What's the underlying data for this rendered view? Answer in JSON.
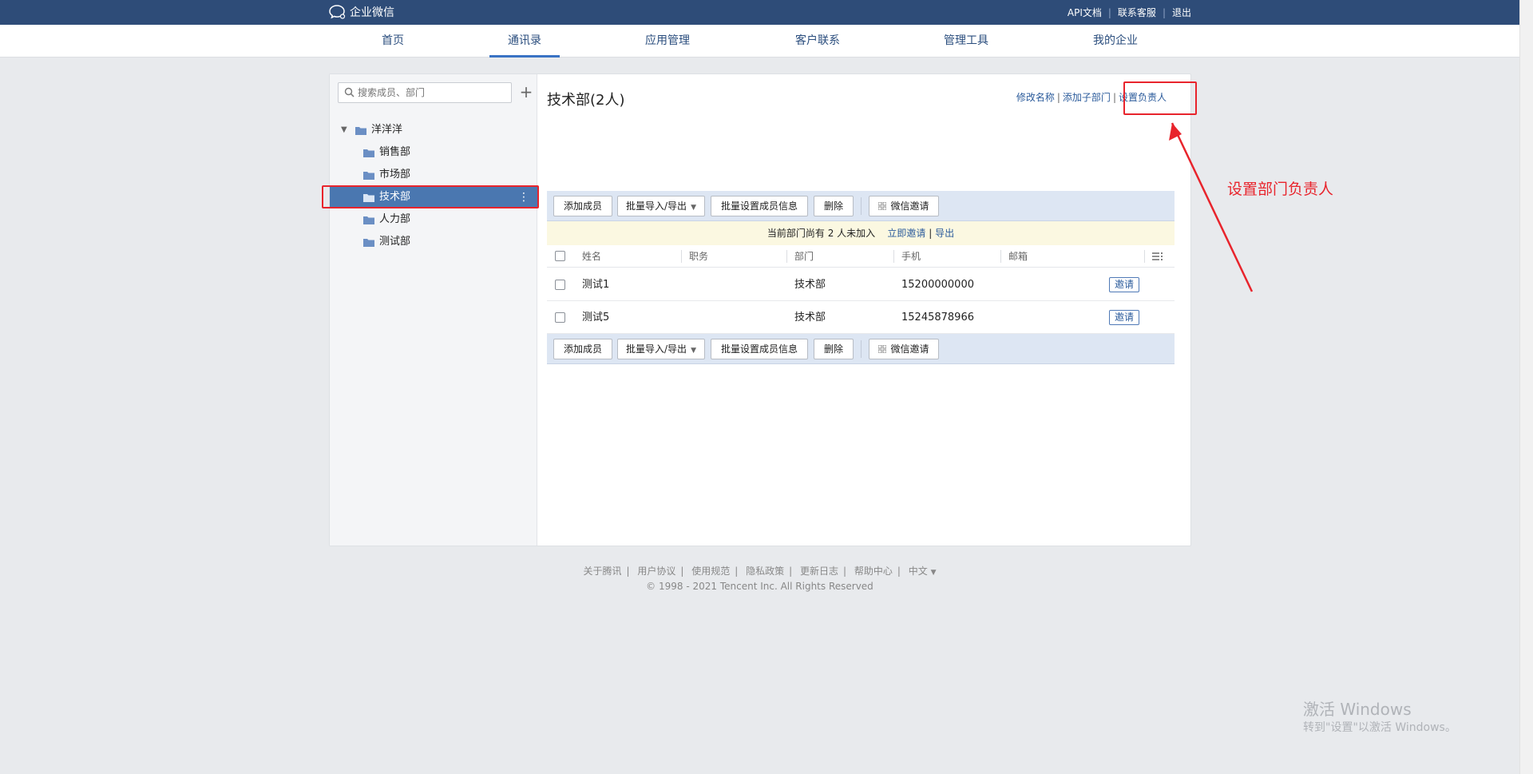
{
  "topbar": {
    "logo_text": "企业微信",
    "links": [
      "API文档",
      "联系客服",
      "退出"
    ]
  },
  "nav": {
    "items": [
      "首页",
      "通讯录",
      "应用管理",
      "客户联系",
      "管理工具",
      "我的企业"
    ],
    "active": "通讯录"
  },
  "sidebar": {
    "search_placeholder": "搜索成员、部门",
    "root": "洋洋洋",
    "departments": [
      "销售部",
      "市场部",
      "技术部",
      "人力部",
      "测试部"
    ],
    "selected": "技术部"
  },
  "content": {
    "title": "技术部(2人)",
    "actions": [
      "修改名称",
      "添加子部门",
      "设置负责人"
    ],
    "toolbar": {
      "add_member": "添加成员",
      "batch_import": "批量导入/导出",
      "batch_set": "批量设置成员信息",
      "delete": "删除",
      "wechat_invite": "微信邀请"
    },
    "notice": {
      "text": "当前部门尚有 2 人未加入",
      "invite_now": "立即邀请",
      "export": "导出"
    },
    "columns": [
      "姓名",
      "职务",
      "部门",
      "手机",
      "邮箱"
    ],
    "rows": [
      {
        "name": "测试1",
        "title": "",
        "dept": "技术部",
        "phone": "15200000000",
        "email": "",
        "action": "邀请"
      },
      {
        "name": "测试5",
        "title": "",
        "dept": "技术部",
        "phone": "15245878966",
        "email": "",
        "action": "邀请"
      }
    ]
  },
  "footer": {
    "links": [
      "关于腾讯",
      "用户协议",
      "使用规范",
      "隐私政策",
      "更新日志",
      "帮助中心",
      "中文"
    ],
    "copyright": "© 1998 - 2021 Tencent Inc. All Rights Reserved"
  },
  "annotation": {
    "text": "设置部门负责人",
    "color": "#e8242c"
  },
  "watermark": {
    "line1": "激活 Windows",
    "line2": "转到\"设置\"以激活 Windows。"
  }
}
